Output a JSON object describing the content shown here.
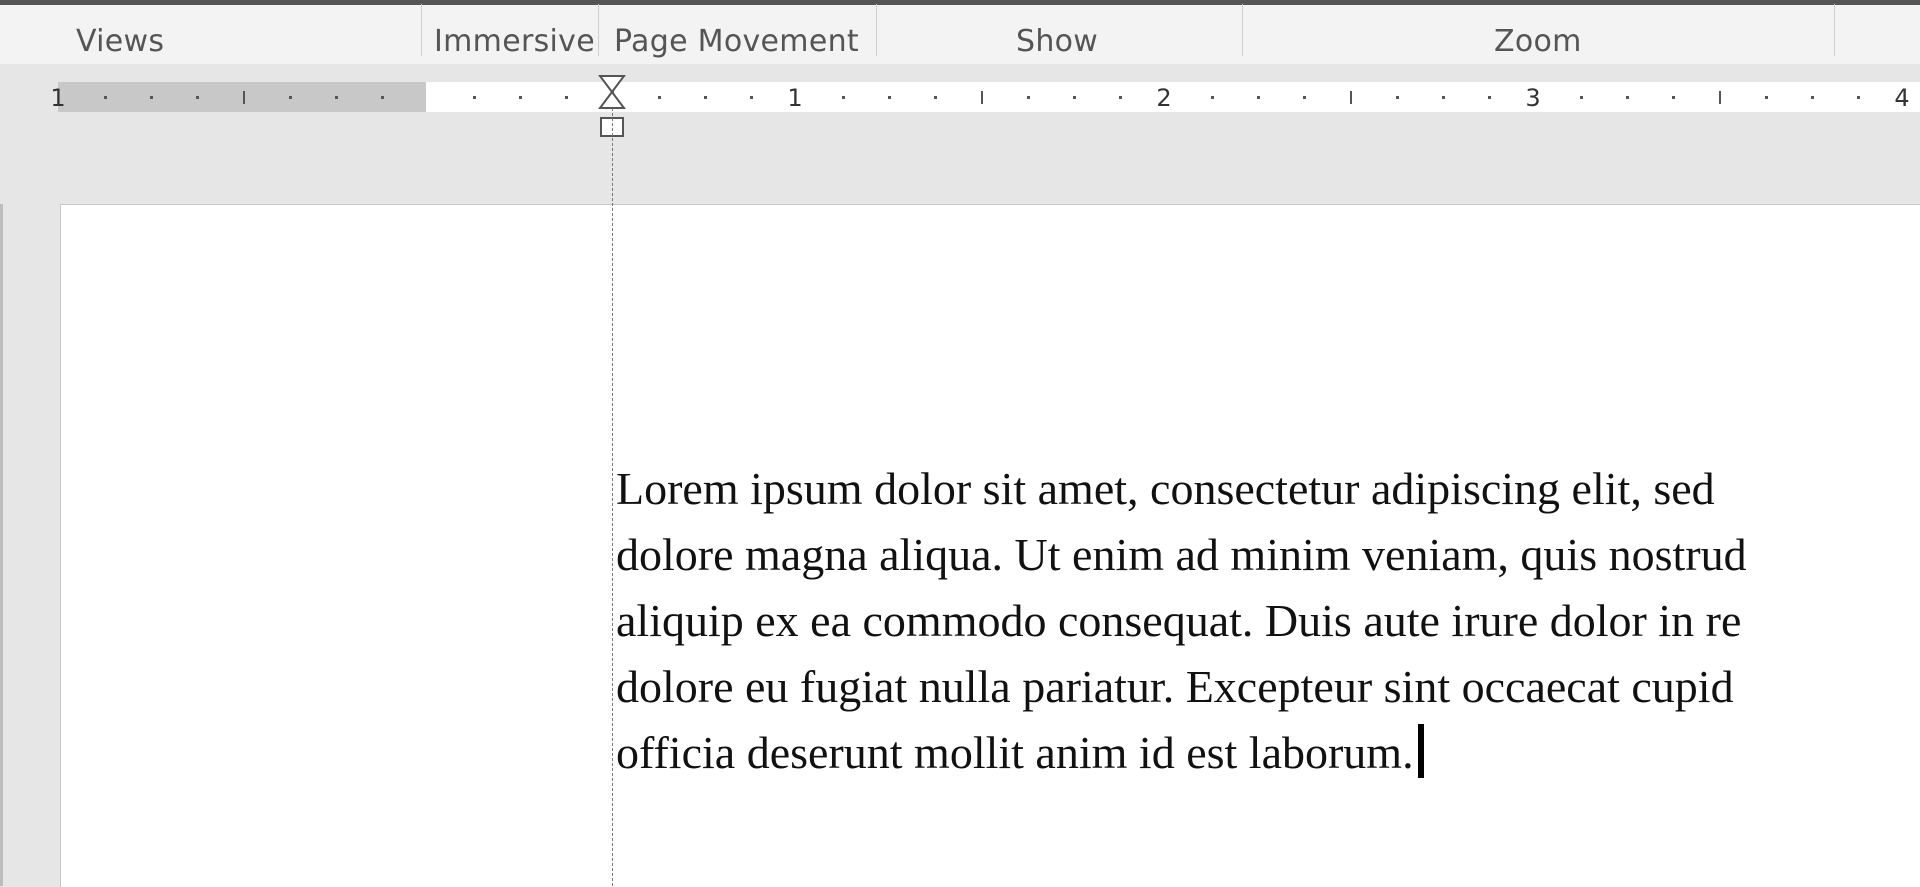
{
  "ribbon": {
    "groups": [
      {
        "id": "views",
        "label": "Views"
      },
      {
        "id": "immersive",
        "label": "Immersive"
      },
      {
        "id": "page-movement",
        "label": "Page Movement"
      },
      {
        "id": "show",
        "label": "Show"
      },
      {
        "id": "zoom",
        "label": "Zoom"
      }
    ]
  },
  "ruler": {
    "numbers": [
      "1",
      "1",
      "2",
      "3",
      "4"
    ]
  },
  "document": {
    "lines": [
      "Lorem ipsum dolor sit amet, consectetur adipiscing elit, sed",
      "dolore magna aliqua. Ut enim ad minim veniam, quis nostrud",
      "aliquip ex ea commodo consequat. Duis aute irure dolor in re",
      "dolore eu fugiat nulla pariatur. Excepteur sint occaecat cupid",
      "officia deserunt mollit anim id est laborum."
    ]
  },
  "colors": {
    "ribbon_bg": "#f3f3f3",
    "app_bg": "#e6e6e6",
    "ruler_margin": "#c8c8c8",
    "label_text": "#555555"
  },
  "icons": {
    "indent_marker": "hanging-indent-marker-icon"
  }
}
